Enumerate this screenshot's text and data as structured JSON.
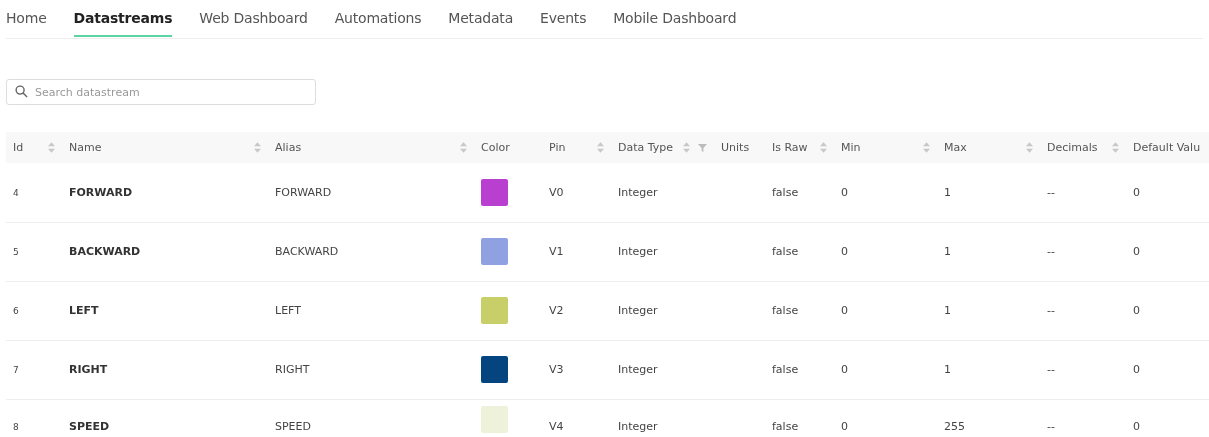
{
  "tabs": [
    {
      "label": "Home",
      "selected": false
    },
    {
      "label": "Datastreams",
      "selected": true
    },
    {
      "label": "Web Dashboard",
      "selected": false
    },
    {
      "label": "Automations",
      "selected": false
    },
    {
      "label": "Metadata",
      "selected": false
    },
    {
      "label": "Events",
      "selected": false
    },
    {
      "label": "Mobile Dashboard",
      "selected": false
    }
  ],
  "search": {
    "placeholder": "Search datastream"
  },
  "table": {
    "columns": [
      {
        "label": "Id",
        "sortable": true,
        "filter": false
      },
      {
        "label": "Name",
        "sortable": true,
        "filter": false
      },
      {
        "label": "Alias",
        "sortable": true,
        "filter": false
      },
      {
        "label": "Color",
        "sortable": false,
        "filter": false
      },
      {
        "label": "Pin",
        "sortable": true,
        "filter": false
      },
      {
        "label": "Data Type",
        "sortable": true,
        "filter": true
      },
      {
        "label": "Units",
        "sortable": false,
        "filter": false
      },
      {
        "label": "Is Raw",
        "sortable": true,
        "filter": false
      },
      {
        "label": "Min",
        "sortable": true,
        "filter": false
      },
      {
        "label": "Max",
        "sortable": true,
        "filter": false
      },
      {
        "label": "Decimals",
        "sortable": true,
        "filter": false
      },
      {
        "label": "Default Valu",
        "sortable": false,
        "filter": false
      }
    ],
    "rows": [
      {
        "id": "4",
        "name": "FORWARD",
        "alias": "FORWARD",
        "color": "#b93fd0",
        "pin": "V0",
        "data_type": "Integer",
        "is_raw": "false",
        "min": "0",
        "max": "1",
        "decimals": "--",
        "default_value": "0"
      },
      {
        "id": "5",
        "name": "BACKWARD",
        "alias": "BACKWARD",
        "color": "#8fa1e0",
        "pin": "V1",
        "data_type": "Integer",
        "is_raw": "false",
        "min": "0",
        "max": "1",
        "decimals": "--",
        "default_value": "0"
      },
      {
        "id": "6",
        "name": "LEFT",
        "alias": "LEFT",
        "color": "#c8ce68",
        "pin": "V2",
        "data_type": "Integer",
        "is_raw": "false",
        "min": "0",
        "max": "1",
        "decimals": "--",
        "default_value": "0"
      },
      {
        "id": "7",
        "name": "RIGHT",
        "alias": "RIGHT",
        "color": "#04447f",
        "pin": "V3",
        "data_type": "Integer",
        "is_raw": "false",
        "min": "0",
        "max": "1",
        "decimals": "--",
        "default_value": "0"
      },
      {
        "id": "8",
        "name": "SPEED",
        "alias": "SPEED",
        "color": "#eff2da",
        "pin": "V4",
        "data_type": "Integer",
        "is_raw": "false",
        "min": "0",
        "max": "255",
        "decimals": "--",
        "default_value": "0"
      }
    ]
  }
}
